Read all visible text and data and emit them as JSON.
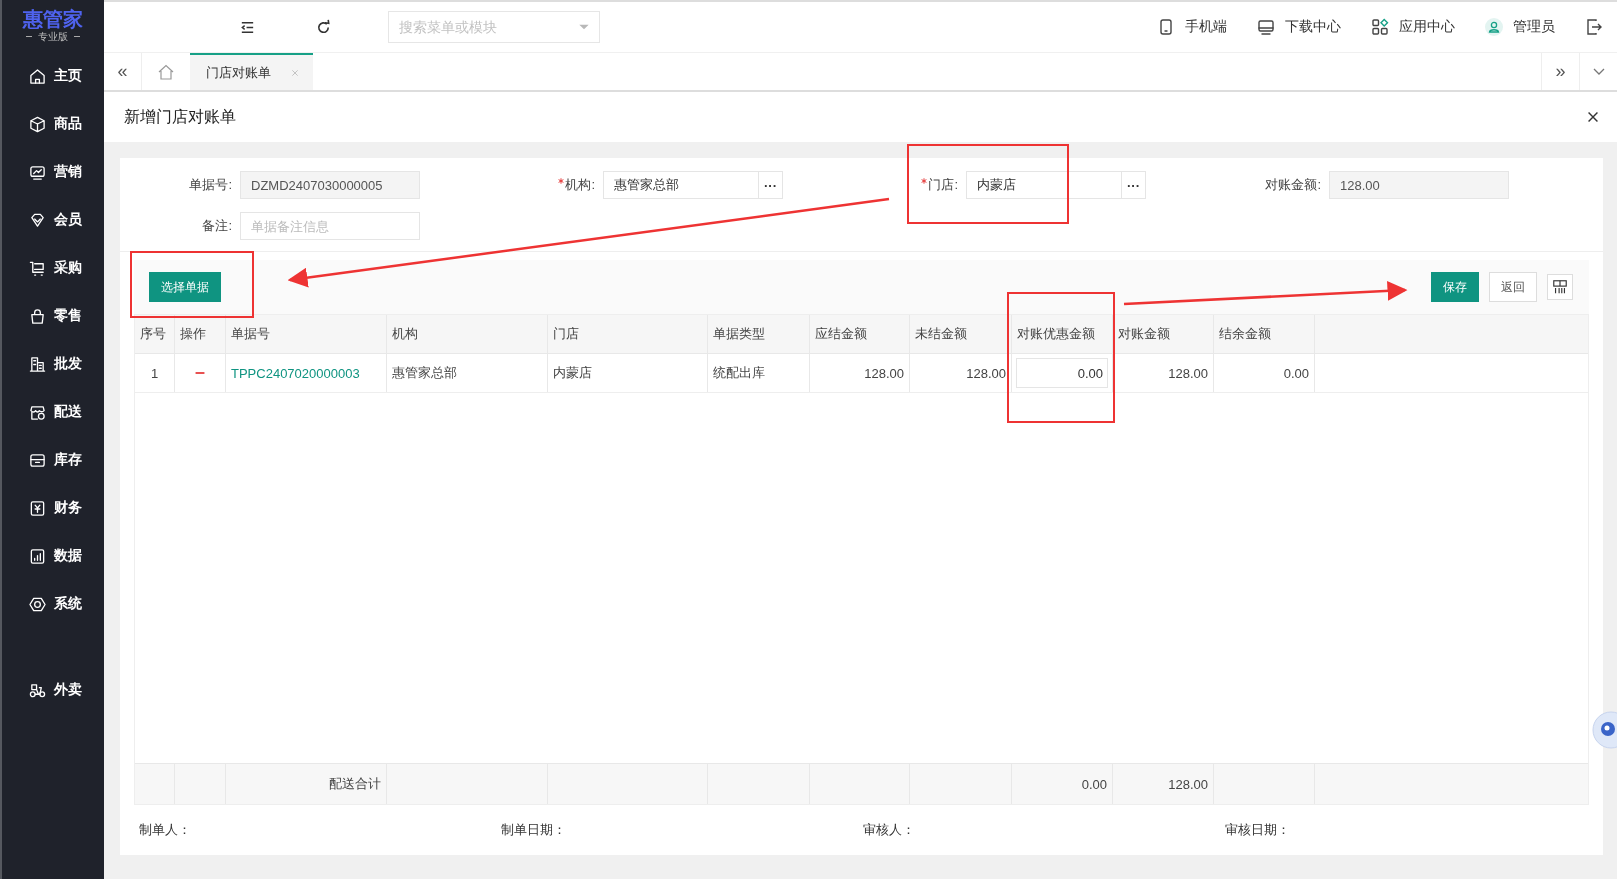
{
  "sidebar": {
    "logo": {
      "title": "惠管家",
      "subtitle": "专业版"
    },
    "items": [
      {
        "label": "主页",
        "kind": "home"
      },
      {
        "label": "商品",
        "kind": "box"
      },
      {
        "label": "营销",
        "kind": "chart"
      },
      {
        "label": "会员",
        "kind": "diamond"
      },
      {
        "label": "采购",
        "kind": "cart"
      },
      {
        "label": "零售",
        "kind": "bag"
      },
      {
        "label": "批发",
        "kind": "building"
      },
      {
        "label": "配送",
        "kind": "store"
      },
      {
        "label": "库存",
        "kind": "archive"
      },
      {
        "label": "财务",
        "kind": "yen"
      },
      {
        "label": "数据",
        "kind": "bars"
      },
      {
        "label": "系统",
        "kind": "hex"
      }
    ],
    "extra_items": [
      {
        "label": "外卖",
        "kind": "scooter"
      }
    ]
  },
  "topbar": {
    "search": {
      "placeholder": "搜索菜单或模块"
    },
    "actions": [
      {
        "label": "手机端",
        "kind": "phone"
      },
      {
        "label": "下载中心",
        "kind": "monitor"
      },
      {
        "label": "应用中心",
        "kind": "apps"
      },
      {
        "label": "管理员",
        "kind": "user"
      }
    ]
  },
  "tab_nav": {
    "left": "«",
    "right": "»"
  },
  "tabs": [
    {
      "label": "门店对账单",
      "selected": true
    }
  ],
  "page": {
    "title": "新增门店对账单",
    "fields": [
      {
        "label": "单据号:",
        "required": false,
        "kind": "readonly",
        "value": "DZMD2407030000005"
      },
      {
        "label": "机构:",
        "required": true,
        "kind": "picker",
        "value": "惠管家总部",
        "button": "···"
      },
      {
        "label": "门店:",
        "required": true,
        "kind": "picker",
        "value": "内蒙店",
        "button": "···"
      },
      {
        "label": "对账金额:",
        "required": false,
        "kind": "readonly",
        "value": "128.00"
      },
      {
        "label": "备注:",
        "required": false,
        "kind": "text",
        "placeholder": "单据备注信息"
      }
    ],
    "left_buttons": [
      {
        "label": "选择单据",
        "kind": "primary"
      }
    ],
    "right_buttons": [
      {
        "label": "保存",
        "kind": "primary"
      },
      {
        "label": "返回",
        "kind": "default"
      }
    ],
    "table": {
      "columns": [
        "序号",
        "操作",
        "单据号",
        "机构",
        "门店",
        "单据类型",
        "应结金额",
        "未结金额",
        "对账优惠金额",
        "对账金额",
        "结余金额"
      ],
      "rows": [
        {
          "cells": [
            {
              "text": "1",
              "kind": "index"
            },
            {
              "kind": "delete"
            },
            {
              "text": "TPPC2407020000003",
              "kind": "link"
            },
            {
              "text": "惠管家总部",
              "kind": "text"
            },
            {
              "text": "内蒙店",
              "kind": "text"
            },
            {
              "text": "统配出库",
              "kind": "text"
            },
            {
              "text": "128.00",
              "kind": "number"
            },
            {
              "text": "128.00",
              "kind": "number"
            },
            {
              "text": "0.00",
              "kind": "input"
            },
            {
              "text": "128.00",
              "kind": "number"
            },
            {
              "text": "0.00",
              "kind": "number"
            }
          ]
        }
      ],
      "totals": [
        {
          "kind": "empty"
        },
        {
          "kind": "empty"
        },
        {
          "text": "配送合计",
          "kind": "number"
        },
        {
          "kind": "empty"
        },
        {
          "kind": "empty"
        },
        {
          "kind": "empty"
        },
        {
          "kind": "empty"
        },
        {
          "kind": "empty"
        },
        {
          "text": "0.00",
          "kind": "number"
        },
        {
          "text": "128.00",
          "kind": "number"
        },
        {
          "kind": "empty"
        }
      ]
    },
    "footer": [
      "制单人：",
      "制单日期：",
      "审核人：",
      "审核日期："
    ]
  }
}
